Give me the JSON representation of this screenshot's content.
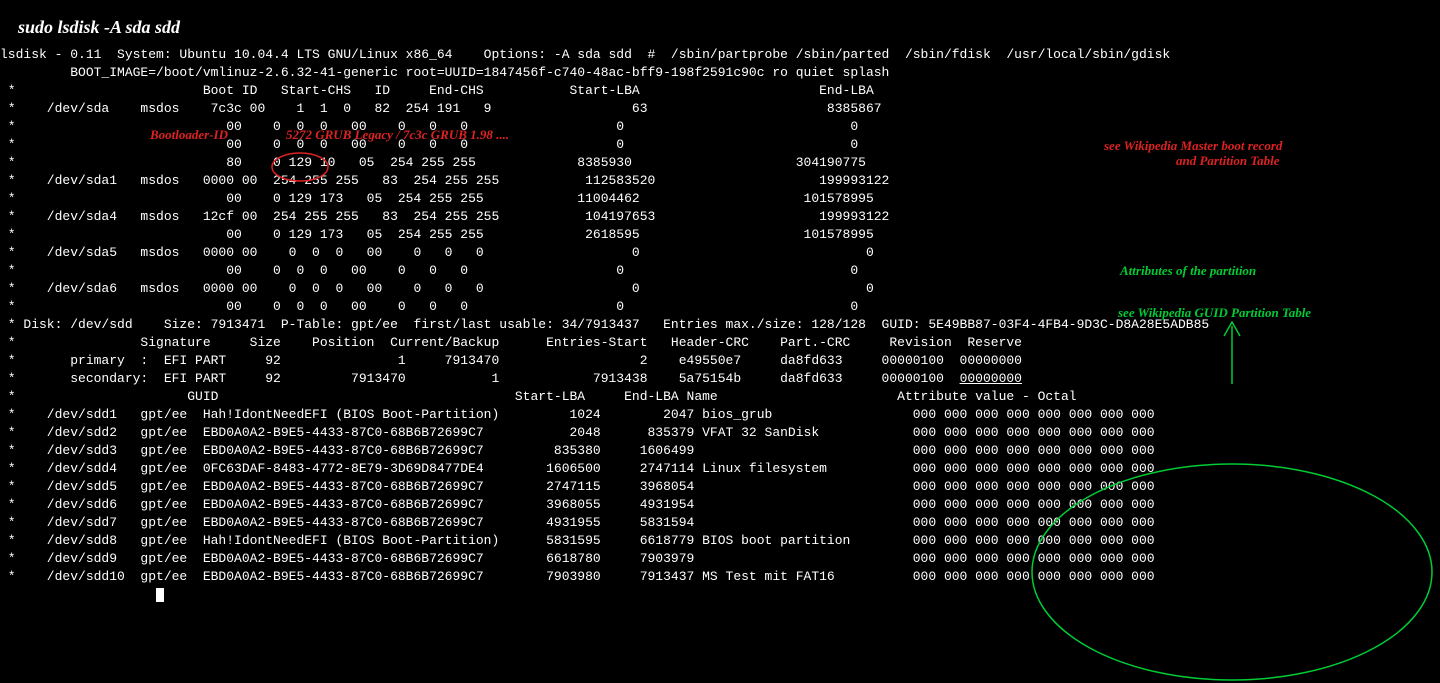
{
  "command": "sudo lsdisk -A  sda sdd",
  "header1": "lsdisk - 0.11  System: Ubuntu 10.04.4 LTS GNU/Linux x86_64    Options: -A sda sdd  #  /sbin/partprobe /sbin/parted  /sbin/fdisk  /usr/local/sbin/gdisk",
  "header2": "         BOOT_IMAGE=/boot/vmlinuz-2.6.32-41-generic root=UUID=1847456f-c740-48ac-bff9-198f2591c90c ro quiet splash",
  "mbr_header": " *                        Boot ID   Start-CHS   ID     End-CHS           Start-LBA                       End-LBA",
  "mbr_rows": [
    " *    /dev/sda    msdos    7c3c 00    1  1  0   82  254 191   9                  63                       8385867",
    " *                           00    0  0  0   00    0   0   0                   0                             0",
    " *                           00    0  0  0   00    0   0   0                   0                             0",
    " *                           80    0 129 10   05  254 255 255             8385930                     304190775",
    " *    /dev/sda1   msdos   0000 00  254 255 255   83  254 255 255           112583520                     199993122",
    " *                           00    0 129 173   05  254 255 255            11004462                     101578995",
    " *    /dev/sda4   msdos   12cf 00  254 255 255   83  254 255 255           104197653                     199993122",
    " *                           00    0 129 173   05  254 255 255             2618595                     101578995",
    " *    /dev/sda5   msdos   0000 00    0  0  0   00    0   0   0                   0                             0",
    " *                           00    0  0  0   00    0   0   0                   0                             0",
    " *    /dev/sda6   msdos   0000 00    0  0  0   00    0   0   0                   0                             0",
    " *                           00    0  0  0   00    0   0   0                   0                             0"
  ],
  "disk_info": " * Disk: /dev/sdd    Size: 7913471  P-Table: gpt/ee  first/last usable: 34/7913437   Entries max./size: 128/128  GUID: 5E49BB87-03F4-4FB4-9D3C-D8A28E5ADB85",
  "gpt_hdr_header": " *                Signature     Size    Position  Current/Backup      Entries-Start   Header-CRC    Part.-CRC     Revision  Reserve",
  "gpt_hdr_rows": [
    {
      "text": " *       primary  :  EFI PART     92               1     7913470                  2    e49550e7     da8fd633     00000100  00000000",
      "reserve_underline": false
    },
    {
      "text": " *       secondary:  EFI PART     92         7913470           1            7913438    5a75154b     da8fd633     00000100  ",
      "reserve_underline": true,
      "reserve": "00000000"
    }
  ],
  "gpt_part_header": " *                      GUID                                      Start-LBA     End-LBA Name                       Attribute value - Octal",
  "gpt_rows": [
    " *    /dev/sdd1   gpt/ee  Hah!IdontNeedEFI (BIOS Boot-Partition)         1024        2047 bios_grub                  000 000 000 000 000 000 000 000",
    " *    /dev/sdd2   gpt/ee  EBD0A0A2-B9E5-4433-87C0-68B6B72699C7           2048      835379 VFAT 32 SanDisk            000 000 000 000 000 000 000 000",
    " *    /dev/sdd3   gpt/ee  EBD0A0A2-B9E5-4433-87C0-68B6B72699C7         835380     1606499                            000 000 000 000 000 000 000 000",
    " *    /dev/sdd4   gpt/ee  0FC63DAF-8483-4772-8E79-3D69D8477DE4        1606500     2747114 Linux filesystem           000 000 000 000 000 000 000 000",
    " *    /dev/sdd5   gpt/ee  EBD0A0A2-B9E5-4433-87C0-68B6B72699C7        2747115     3968054                            000 000 000 000 000 000 000 000",
    " *    /dev/sdd6   gpt/ee  EBD0A0A2-B9E5-4433-87C0-68B6B72699C7        3968055     4931954                            000 000 000 000 000 000 000 000",
    " *    /dev/sdd7   gpt/ee  EBD0A0A2-B9E5-4433-87C0-68B6B72699C7        4931955     5831594                            000 000 000 000 000 000 000 000",
    " *    /dev/sdd8   gpt/ee  Hah!IdontNeedEFI (BIOS Boot-Partition)      5831595     6618779 BIOS boot partition        000 000 000 000 000 000 000 000",
    " *    /dev/sdd9   gpt/ee  EBD0A0A2-B9E5-4433-87C0-68B6B72699C7        6618780     7903979                            000 000 000 000 000 000 000 000",
    " *    /dev/sdd10  gpt/ee  EBD0A0A2-B9E5-4433-87C0-68B6B72699C7        7903980     7913437 MS Test mit FAT16          000 000 000 000 000 000 000 000"
  ],
  "annotations": {
    "bootloader_label": "Bootloader-ID",
    "bootloader_desc": "5272 GRUB Legacy / 7c3c GRUB 1.98 ....",
    "mbr_link1": "see Wikipedia Master boot record",
    "mbr_link2": "and Partition Table",
    "attr_label": "Attributes of the partition",
    "gpt_link": "see Wikipedia GUID Partition Table"
  }
}
